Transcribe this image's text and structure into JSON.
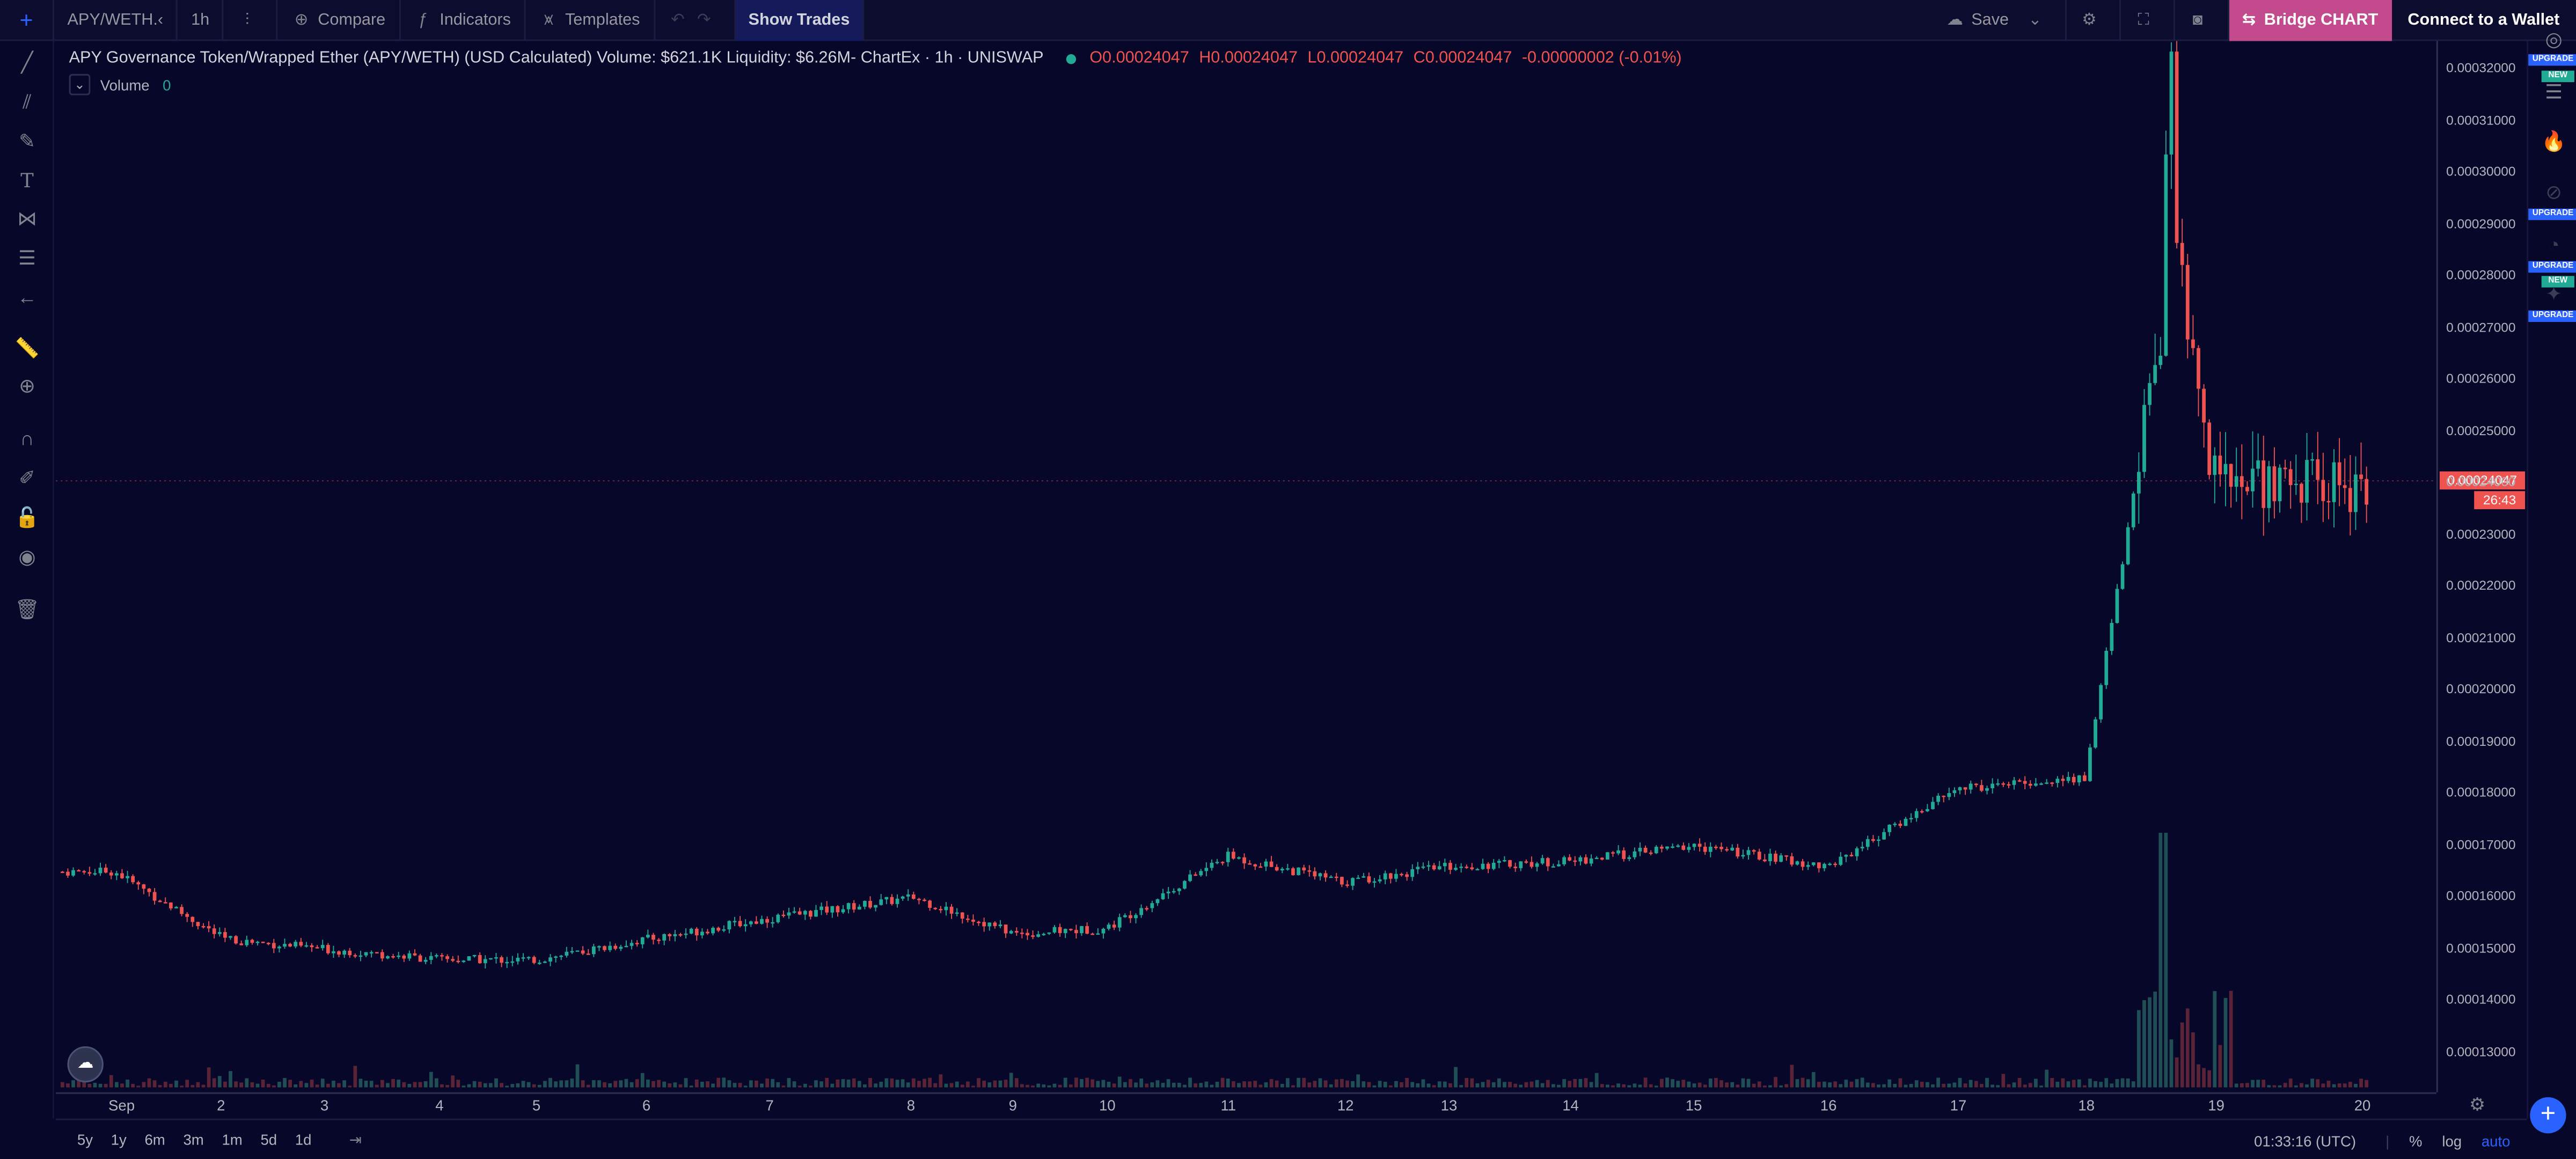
{
  "topbar": {
    "symbol": "APY/WETH.‹",
    "interval": "1h",
    "compare": "Compare",
    "indicators": "Indicators",
    "templates": "Templates",
    "show_trades": "Show Trades",
    "save": "Save",
    "bridge": "Bridge CHART",
    "wallet": "Connect to a Wallet"
  },
  "legend": {
    "title": "APY Governance Token/Wrapped Ether (APY/WETH) (USD Calculated) Volume: $621.1K Liquidity: $6.26M- ChartEx · 1h · UNISWAP",
    "o": "O0.00024047",
    "h": "H0.00024047",
    "l": "L0.00024047",
    "c": "C0.00024047",
    "chg": "-0.00000002 (-0.01%)",
    "volume_label": "Volume",
    "volume_value": "0"
  },
  "rightbar": {
    "upgrade": "UPGRADE",
    "new": "NEW"
  },
  "price_tag": "0.00024047",
  "countdown": "26:43",
  "bottom": {
    "ranges": [
      "5y",
      "1y",
      "6m",
      "3m",
      "1m",
      "5d",
      "1d"
    ],
    "clock": "01:33:16 (UTC)",
    "pct": "%",
    "log": "log",
    "auto": "auto"
  },
  "colors": {
    "up": "#22ab94",
    "down": "#ef5350",
    "bg": "#07072a",
    "accent": "#2962ff"
  },
  "chart_data": {
    "type": "candlestick",
    "title": "APY Governance Token/Wrapped Ether (APY/WETH) (USD Calculated)",
    "interval": "1h",
    "x_tick_labels": [
      "Sep",
      "2",
      "3",
      "4",
      "5",
      "6",
      "7",
      "8",
      "9",
      "10",
      "11",
      "12",
      "13",
      "14",
      "15",
      "16",
      "17",
      "18",
      "19",
      "20"
    ],
    "y_tick_labels": [
      "0.00032000",
      "0.00031000",
      "0.00030000",
      "0.00029000",
      "0.00028000",
      "0.00027000",
      "0.00026000",
      "0.00025000",
      "0.00024000",
      "0.00023000",
      "0.00022000",
      "0.00021000",
      "0.00020000",
      "0.00019000",
      "0.00018000",
      "0.00017000",
      "0.00016000",
      "0.00015000",
      "0.00014000",
      "0.00013000"
    ],
    "ylim": [
      0.000124,
      0.000324
    ],
    "last_price": 0.00024047,
    "daily_close": [
      {
        "x": "Sep",
        "close": 0.000165
      },
      {
        "x": "2",
        "close": 0.000152
      },
      {
        "x": "3",
        "close": 0.00015
      },
      {
        "x": "4",
        "close": 0.000148
      },
      {
        "x": "5",
        "close": 0.000148
      },
      {
        "x": "6",
        "close": 0.000152
      },
      {
        "x": "7",
        "close": 0.000156
      },
      {
        "x": "8",
        "close": 0.00016
      },
      {
        "x": "9",
        "close": 0.000153
      },
      {
        "x": "10",
        "close": 0.000154
      },
      {
        "x": "11",
        "close": 0.000168
      },
      {
        "x": "12",
        "close": 0.000163
      },
      {
        "x": "13",
        "close": 0.000166
      },
      {
        "x": "14",
        "close": 0.000167
      },
      {
        "x": "15",
        "close": 0.00017
      },
      {
        "x": "16",
        "close": 0.000166
      },
      {
        "x": "17",
        "close": 0.000181
      },
      {
        "x": "18",
        "close": 0.000183
      },
      {
        "x": "18.6",
        "close": 0.00028
      },
      {
        "x": "19",
        "close": 0.000241
      },
      {
        "x": "20",
        "close": 0.00024
      }
    ]
  }
}
